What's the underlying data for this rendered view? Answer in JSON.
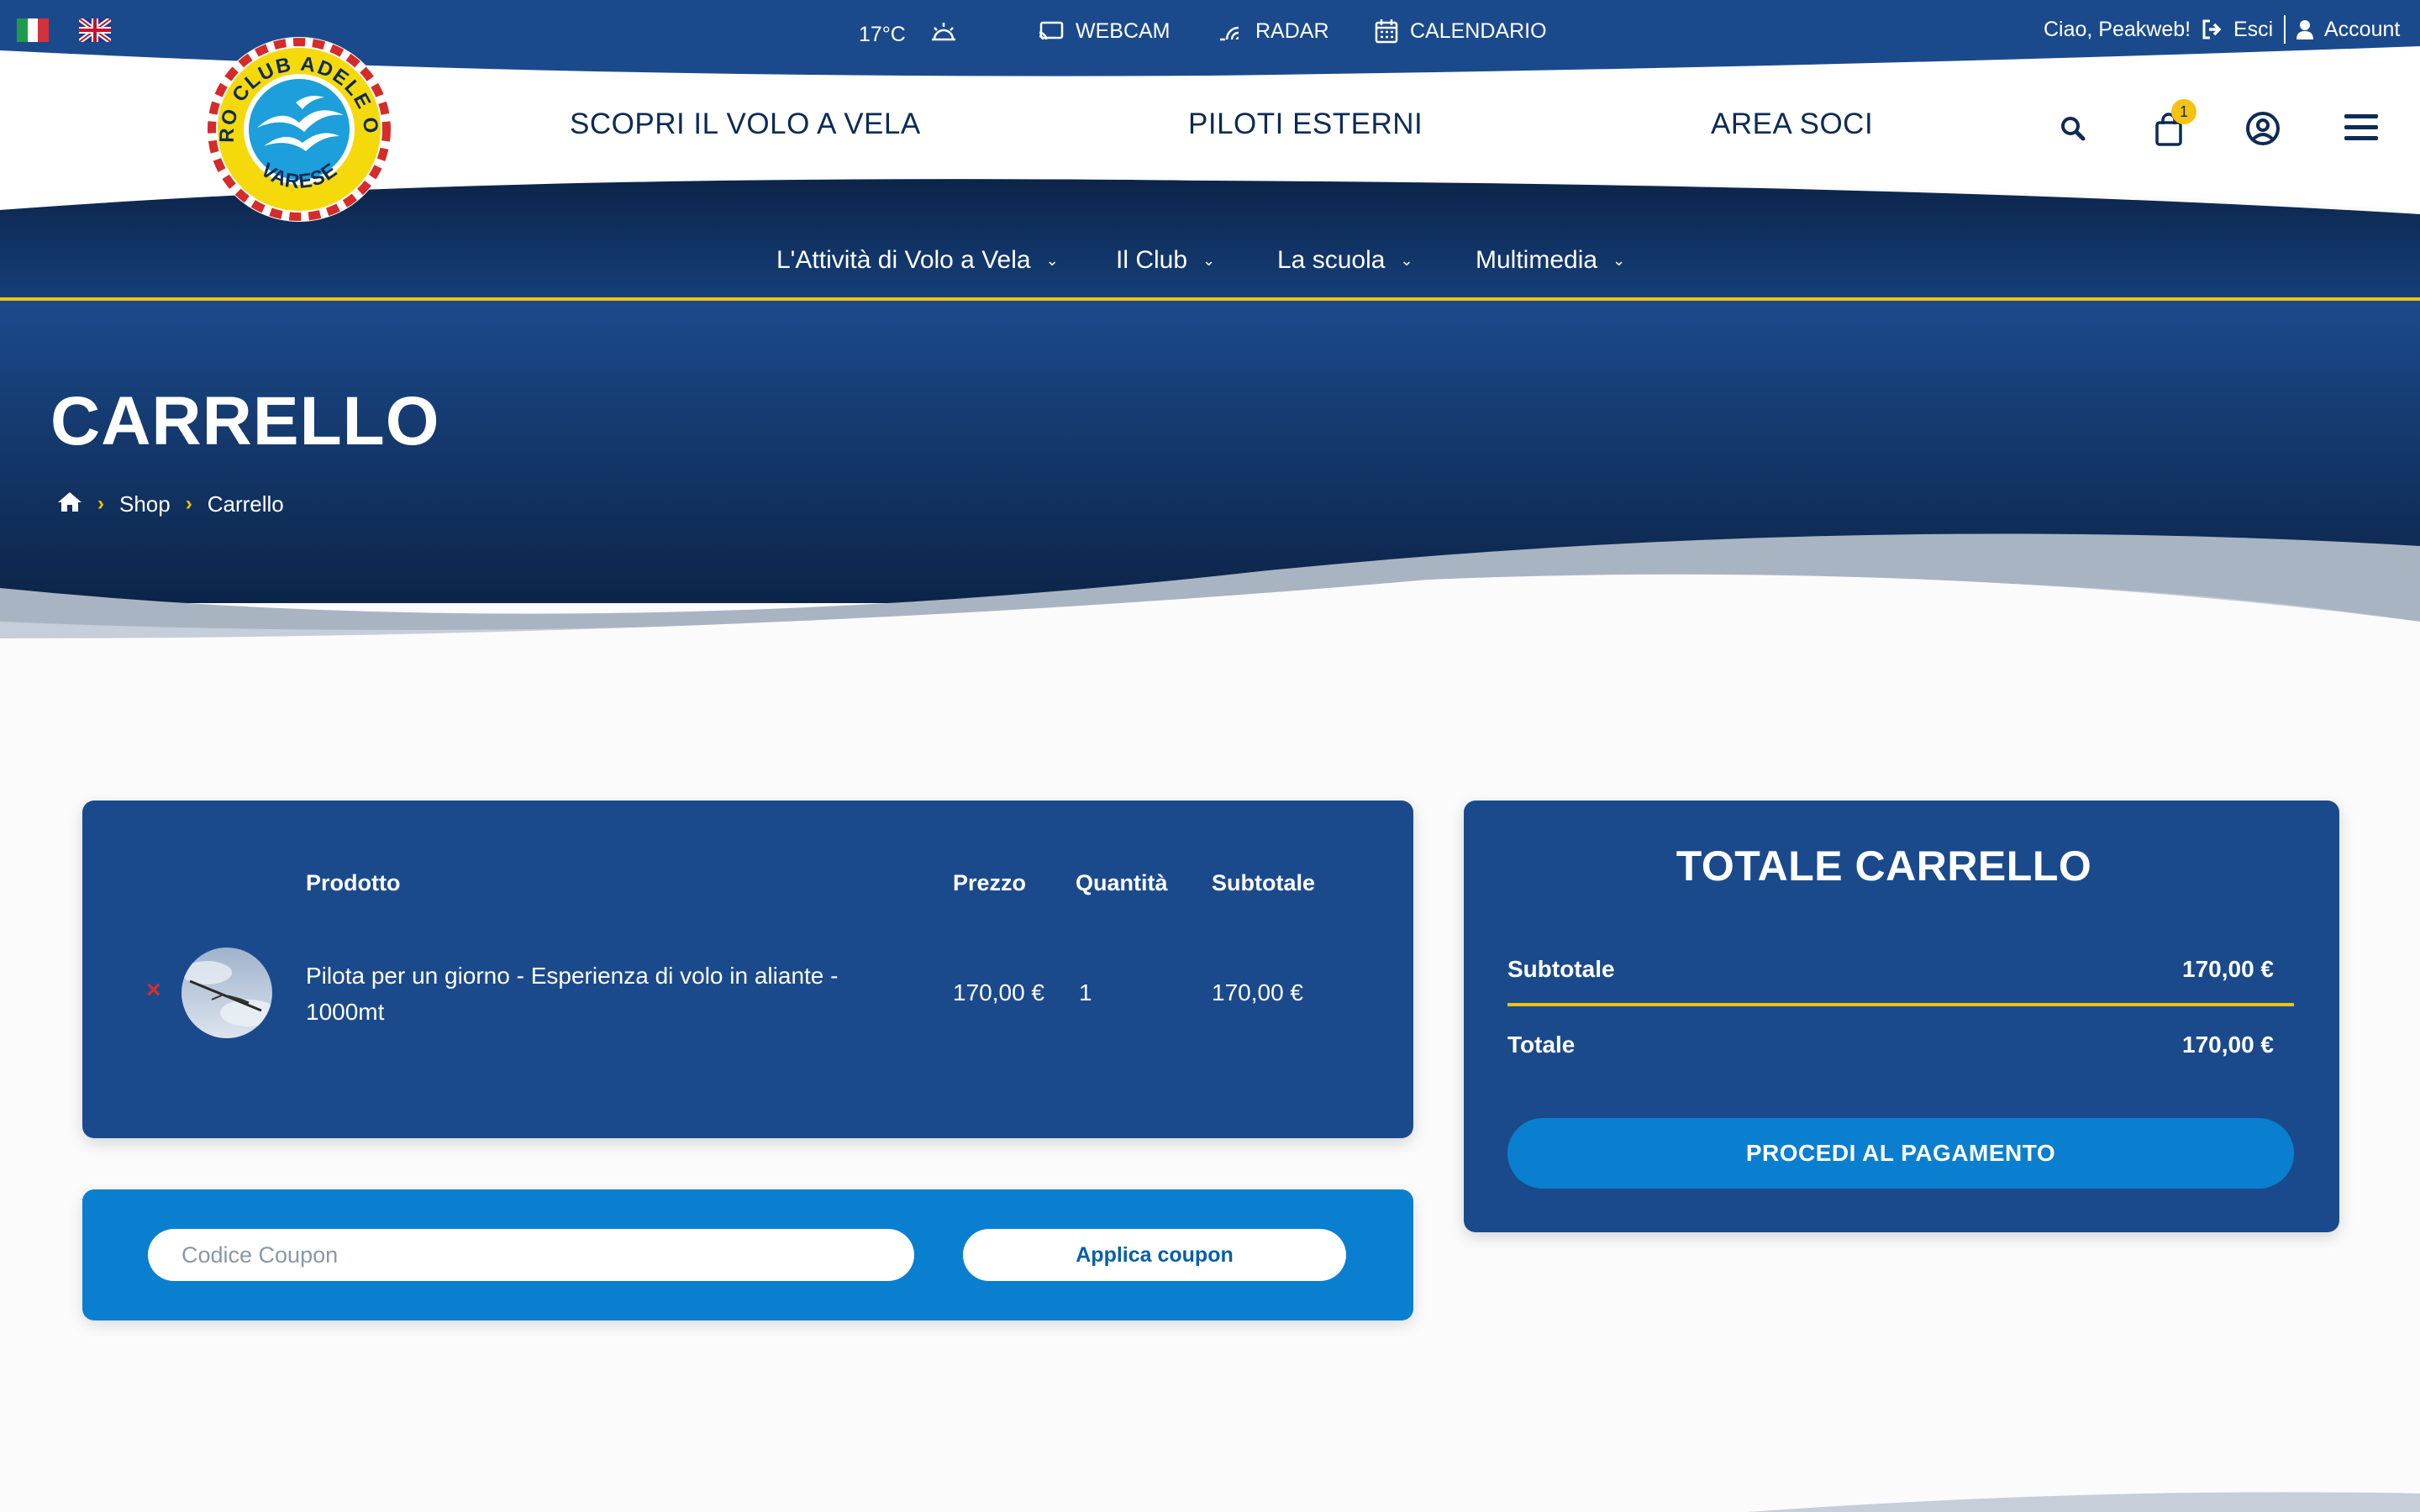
{
  "topbar": {
    "temperature": "17°C",
    "weather_icon": "sunrise-icon",
    "links": [
      {
        "label": "WEBCAM",
        "icon": "cast-icon"
      },
      {
        "label": "RADAR",
        "icon": "radar-icon"
      },
      {
        "label": "CALENDARIO",
        "icon": "calendar-icon"
      }
    ],
    "greeting": "Ciao, Peakweb!",
    "logout_label": "Esci",
    "account_label": "Account"
  },
  "logo": {
    "top_text": "AERO CLUB ADELE ORSI",
    "bottom_text": "VARESE"
  },
  "mainnav": {
    "items": [
      "SCOPRI IL VOLO A VELA",
      "PILOTI ESTERNI",
      "AREA SOCI"
    ],
    "cart_count": "1"
  },
  "subnav": {
    "items": [
      "L'Attività di Volo a Vela",
      "Il Club",
      "La scuola",
      "Multimedia"
    ]
  },
  "hero": {
    "title": "CARRELLO",
    "breadcrumb": [
      "Shop",
      "Carrello"
    ]
  },
  "cart": {
    "headers": {
      "product": "Prodotto",
      "price": "Prezzo",
      "quantity": "Quantità",
      "subtotal": "Subtotale"
    },
    "rows": [
      {
        "remove": "×",
        "name_line1": "Pilota per un giorno - Esperienza di volo in aliante -",
        "name_line2": "1000mt",
        "price": "170,00 €",
        "quantity": "1",
        "subtotal": "170,00 €"
      }
    ]
  },
  "coupon": {
    "placeholder": "Codice Coupon",
    "button": "Applica coupon"
  },
  "totals": {
    "title": "TOTALE CARRELLO",
    "subtotal_label": "Subtotale",
    "subtotal_value": "170,00 €",
    "total_label": "Totale",
    "total_value": "170,00 €",
    "checkout": "PROCEDI AL PAGAMENTO"
  },
  "colors": {
    "navy": "#1b4a8c",
    "dark_navy": "#0d2b55",
    "accent_yellow": "#f5c211",
    "button_blue": "#0a7fcf"
  }
}
